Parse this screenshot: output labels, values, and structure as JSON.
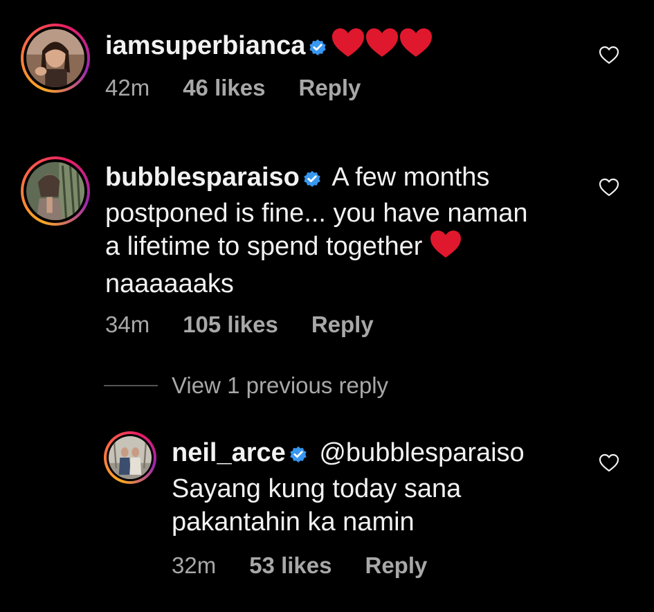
{
  "comments": [
    {
      "username": "iamsuperbianca",
      "text": "",
      "emoji": "heart-emoji x3",
      "time": "42m",
      "likes": "46 likes",
      "reply": "Reply"
    },
    {
      "username": "bubblesparaiso",
      "text_line1": "A few months",
      "text_line2": "postponed is fine... you have naman",
      "text_line3": "a lifetime to spend together",
      "text_line4": "naaaaaaks",
      "emoji": "heart-emoji",
      "time": "34m",
      "likes": "105 likes",
      "reply": "Reply"
    },
    {
      "username": "neil_arce",
      "mention": "@bubblesparaiso",
      "text_line1": "Sayang kung today sana",
      "text_line2": "pakantahin ka namin",
      "time": "32m",
      "likes": "53 likes",
      "reply": "Reply"
    }
  ],
  "view_replies": "View 1 previous reply",
  "colors": {
    "background": "#000000",
    "text": "#f2f2f2",
    "meta": "#a8a8a8",
    "verified": "#3897f0",
    "heart": "#e0182d"
  },
  "icons": [
    "verified-badge-icon",
    "heart-emoji",
    "heart-outline-icon"
  ]
}
